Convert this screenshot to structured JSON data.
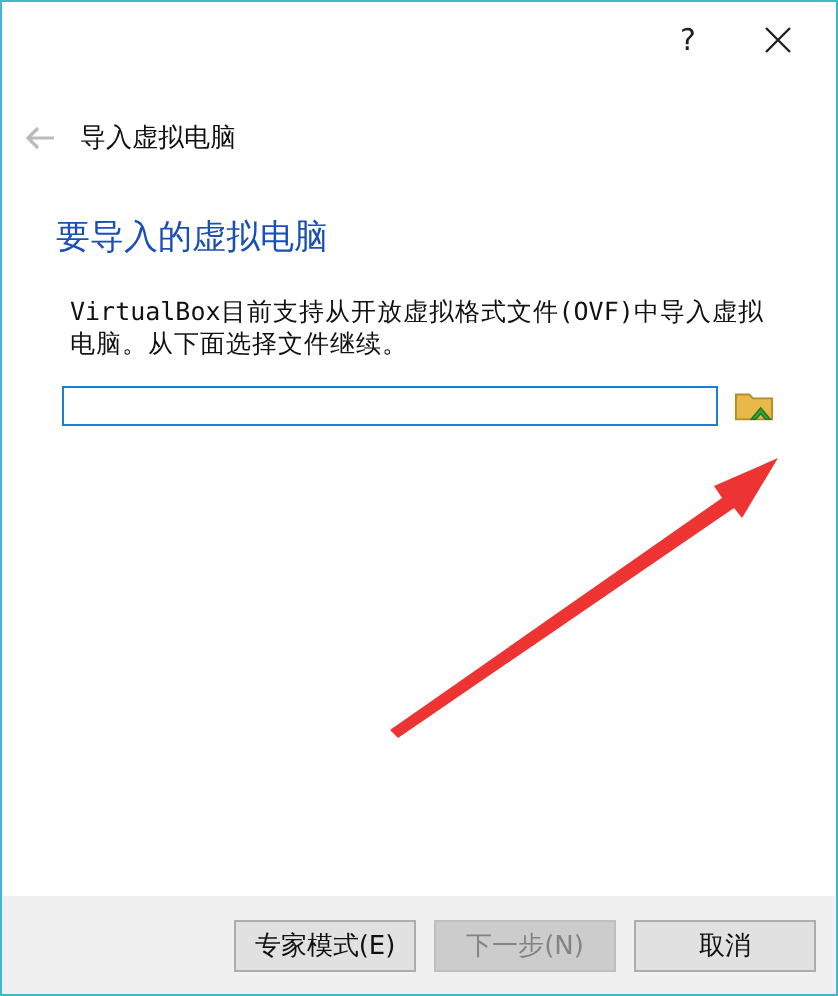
{
  "window": {
    "help": "?",
    "title": "导入虚拟电脑"
  },
  "page": {
    "heading": "要导入的虚拟电脑",
    "description": "VirtualBox目前支持从开放虚拟格式文件(OVF)中导入虚拟电脑。从下面选择文件继续。"
  },
  "buttons": [
    {
      "label": "专家模式(E)",
      "disabled": false
    },
    {
      "label": "下一步(N)",
      "disabled": true
    },
    {
      "label": "取消",
      "disabled": false
    }
  ]
}
